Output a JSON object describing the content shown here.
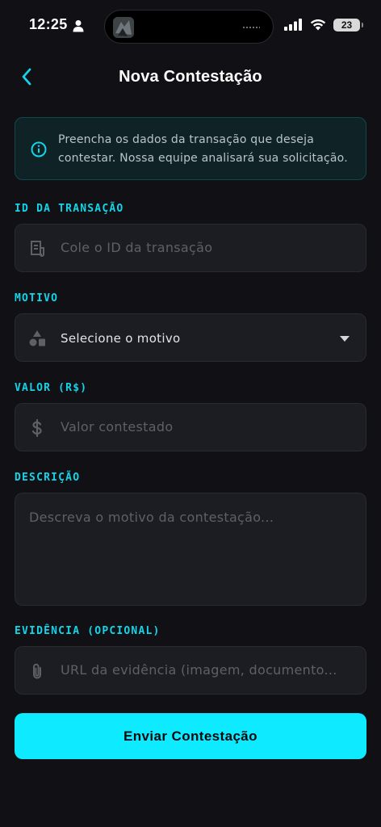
{
  "status_bar": {
    "time": "12:25",
    "battery": "23"
  },
  "header": {
    "title": "Nova Contestação",
    "back_icon": "chevron-left-icon"
  },
  "info": {
    "text": "Preencha os dados da transação que deseja contestar. Nossa equipe analisará sua solicitação.",
    "icon": "info-icon"
  },
  "form": {
    "transaction_id": {
      "label": "ID DA TRANSAÇÃO",
      "placeholder": "Cole o ID da transação",
      "icon": "receipt-icon"
    },
    "reason": {
      "label": "MOTIVO",
      "selected": "Selecione o motivo",
      "icon": "shapes-icon"
    },
    "amount": {
      "label": "VALOR (R$)",
      "placeholder": "Valor contestado",
      "icon": "dollar-icon"
    },
    "description": {
      "label": "DESCRIÇÃO",
      "placeholder": "Descreva o motivo da contestação..."
    },
    "evidence": {
      "label": "EVIDÊNCIA (OPCIONAL)",
      "placeholder": "URL da evidência (imagem, documento...",
      "icon": "paperclip-icon"
    },
    "submit_label": "Enviar Contestação"
  },
  "colors": {
    "accent": "#0eeaff",
    "background": "#111015",
    "field": "#1c1c23"
  }
}
